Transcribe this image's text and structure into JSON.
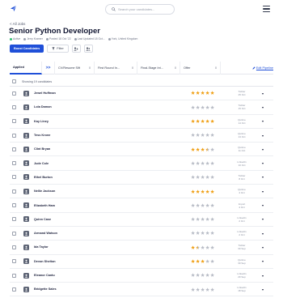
{
  "header": {
    "search_placeholder": "Search your candidates...",
    "logo_icon": "paper-plane-icon",
    "menu_icon": "hamburger-icon"
  },
  "job": {
    "back_label": "< All Jobs",
    "title": "Senior Python Developer",
    "meta": [
      {
        "text": "Active",
        "color": "#2fbf71"
      },
      {
        "text": "Jerry Kramer",
        "color": "#9aa0ad"
      },
      {
        "text": "Posted 18 Oct '22",
        "color": "#9aa0ad"
      },
      {
        "text": "Last Updated 18 Oct...",
        "color": "#9aa0ad"
      },
      {
        "text": "York, United Kingdom",
        "color": "#9aa0ad"
      }
    ]
  },
  "actions": {
    "boost_label": "Boost Candidates",
    "filter_label": "Filter"
  },
  "tabs": {
    "items": [
      {
        "label": "Applied",
        "count": "19"
      },
      {
        "label": "CV/Resume Sift",
        "count": "0"
      },
      {
        "label": "First Round In...",
        "count": "0"
      },
      {
        "label": "Final-Stage Int...",
        "count": "0"
      },
      {
        "label": "Offer",
        "count": "0"
      }
    ],
    "arrows": ">>",
    "edit_pipeline": "Edit Pipeline"
  },
  "list": {
    "showing": "Showing 19 candidates",
    "accent": "#1f4fd8",
    "star_color": "#f0a21b",
    "star_empty": "#b9bdc7",
    "candidates": [
      {
        "name": "Jewel Huffman",
        "rating": 5,
        "source": "Twitter",
        "date": "25 Oct"
      },
      {
        "name": "Lola Damon",
        "rating": 0,
        "source": "Twitter",
        "date": "15 Oct"
      },
      {
        "name": "Kay Liney",
        "rating": 5,
        "source": "Quitme",
        "date": "14 Oct"
      },
      {
        "name": "Tess Krone",
        "rating": 0,
        "source": "Quitme",
        "date": "13 Oct"
      },
      {
        "name": "Clint Bryan",
        "rating": 3.5,
        "source": "Quitme",
        "date": "11 Oct"
      },
      {
        "name": "Jude Cole",
        "rating": 0,
        "source": "Linkedin",
        "date": "10 Oct"
      },
      {
        "name": "Ethel Burton",
        "rating": 0,
        "source": "Twitter",
        "date": "8 Oct"
      },
      {
        "name": "Nellie Jackson",
        "rating": 5,
        "source": "Quitme",
        "date": "4 Oct"
      },
      {
        "name": "Elizabeth Ham",
        "rating": 0,
        "source": "Import",
        "date": "4 Oct"
      },
      {
        "name": "Quinn Case",
        "rating": 0,
        "source": "Linkedin",
        "date": "2 Oct"
      },
      {
        "name": "Armand Watson",
        "rating": 0,
        "source": "Linkedin",
        "date": "2 Oct"
      },
      {
        "name": "Ida Taylor",
        "rating": 1.5,
        "source": "Twitter",
        "date": "30 Sep"
      },
      {
        "name": "Devon Shelton",
        "rating": 3,
        "source": "Quitme",
        "date": "30 Sep"
      },
      {
        "name": "Eleanor Cantu",
        "rating": 0,
        "source": "Linkedin",
        "date": "29 Sep"
      },
      {
        "name": "Bridgette Sales",
        "rating": 0,
        "source": "Linkedin",
        "date": "18 Sep"
      }
    ]
  }
}
